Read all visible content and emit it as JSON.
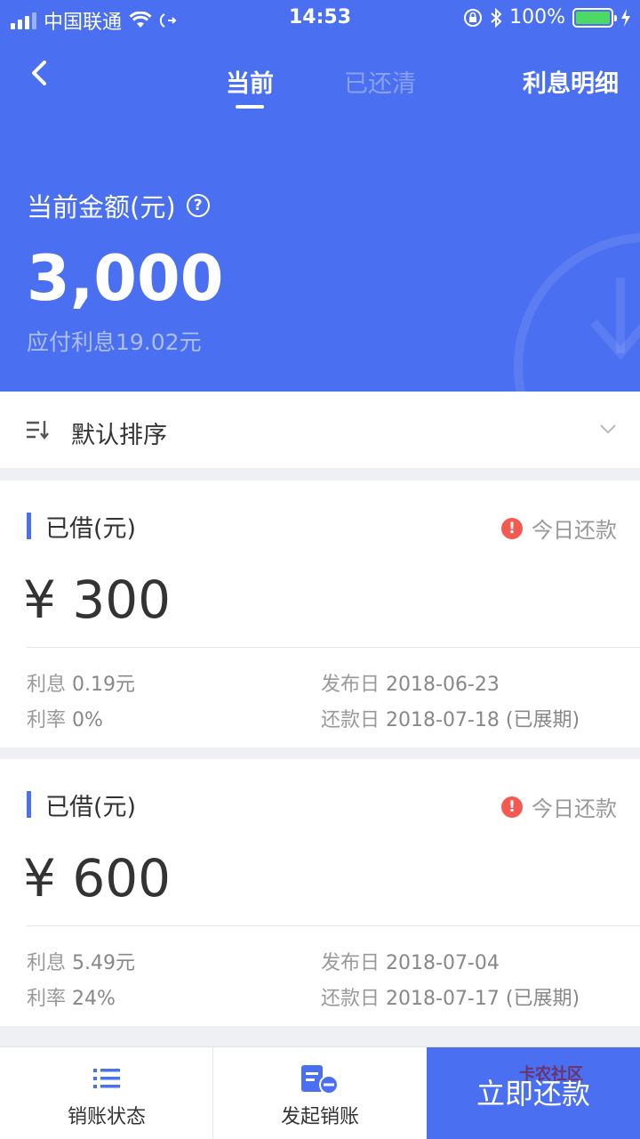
{
  "status_bar": {
    "carrier": "中国联通",
    "time": "14:53",
    "battery": "100%"
  },
  "nav": {
    "tab_current": "当前",
    "tab_cleared": "已还清",
    "interest_detail": "利息明细"
  },
  "summary": {
    "amount_label": "当前金额(元)",
    "amount": "3,000",
    "interest_due": "应付利息19.02元"
  },
  "sort": {
    "label": "默认排序"
  },
  "loans": [
    {
      "title": "已借(元)",
      "status": "今日还款",
      "amount": "¥ 300",
      "interest_label": "利息",
      "interest": "0.19元",
      "rate_label": "利率",
      "rate": "0%",
      "publish_label": "发布日",
      "publish_date": "2018-06-23",
      "repay_label": "还款日",
      "repay_date": "2018-07-18 (已展期)"
    },
    {
      "title": "已借(元)",
      "status": "今日还款",
      "amount": "¥ 600",
      "interest_label": "利息",
      "interest": "5.49元",
      "rate_label": "利率",
      "rate": "24%",
      "publish_label": "发布日",
      "publish_date": "2018-07-04",
      "repay_label": "还款日",
      "repay_date": "2018-07-17 (已展期)"
    }
  ],
  "bottom_bar": {
    "writeoff_status": "销账状态",
    "start_writeoff": "发起销账",
    "repay_now": "立即还款",
    "watermark": "卡农社区"
  },
  "colors": {
    "primary": "#4a6ff0",
    "alert": "#f25a52",
    "battery": "#4cd964"
  }
}
